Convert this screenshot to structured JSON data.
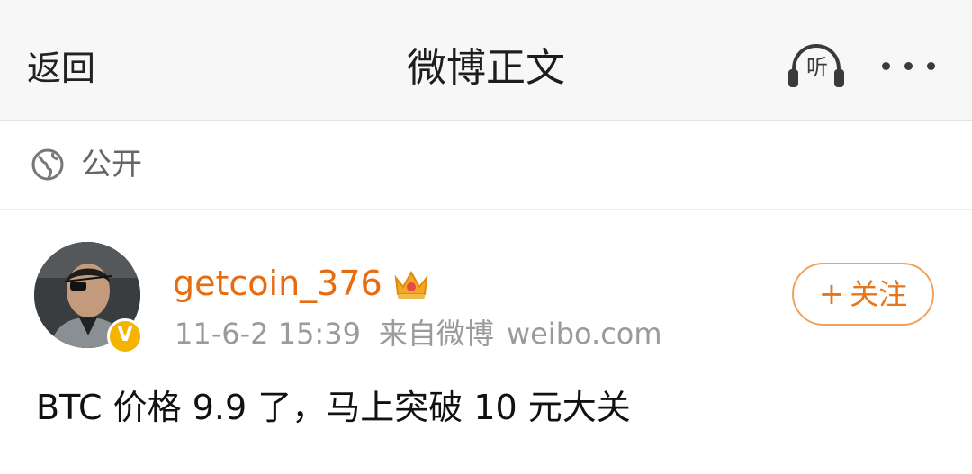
{
  "header": {
    "back_label": "返回",
    "title": "微博正文",
    "listen_label": "听",
    "more_icon": "more-dots-icon"
  },
  "visibility": {
    "icon": "globe-icon",
    "label": "公开"
  },
  "post": {
    "username": "getcoin_376",
    "crown_icon": "crown-icon",
    "verified_badge": "V",
    "date": "11-6-2 15:39",
    "source_prefix": "来自微博",
    "source_site": "weibo.com",
    "follow_label": "关注",
    "follow_plus": "+",
    "text": "BTC 价格 9.9 了，马上突破 10 元大关"
  },
  "colors": {
    "username": "#e86b0f",
    "follow_border": "#f0a35e",
    "meta": "#9a9a9a",
    "header_bg": "#f7f7f7",
    "badge": "#f4b400"
  }
}
